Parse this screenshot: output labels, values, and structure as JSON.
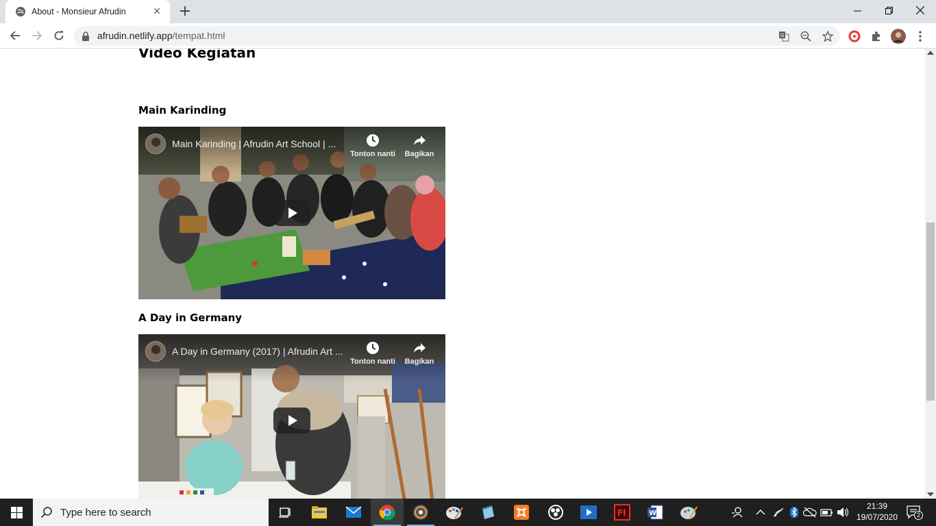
{
  "browser": {
    "tab_title": "About - Monsieur Afrudin",
    "url_host": "afrudin.netlify.app",
    "url_path": "/tempat.html"
  },
  "page": {
    "heading": "Video Kegiatan",
    "videos": [
      {
        "section_title": "Main Karinding",
        "video_title": "Main Karinding | Afrudin Art School | ...",
        "watch_later": "Tonton nanti",
        "share": "Bagikan"
      },
      {
        "section_title": "A Day in Germany",
        "video_title": "A Day in Germany (2017) | Afrudin Art ...",
        "watch_later": "Tonton nanti",
        "share": "Bagikan"
      }
    ]
  },
  "taskbar": {
    "search_placeholder": "Type here to search",
    "time": "21:39",
    "date": "19/07/2020",
    "notification_count": "2",
    "apps": [
      "task-view-icon",
      "file-explorer-icon",
      "mail-icon",
      "chrome-icon",
      "media-player-icon",
      "paint-icon",
      "notepad-icon",
      "xampp-icon",
      "obs-icon",
      "video-editor-icon",
      "flash-icon",
      "word-icon",
      "paint-3d-icon"
    ]
  },
  "colors": {
    "tab_strip": "#dee1e6",
    "omnibox": "#f1f3f4",
    "taskbar": "#1f1f1f",
    "active_indicator": "#76b9ed"
  }
}
